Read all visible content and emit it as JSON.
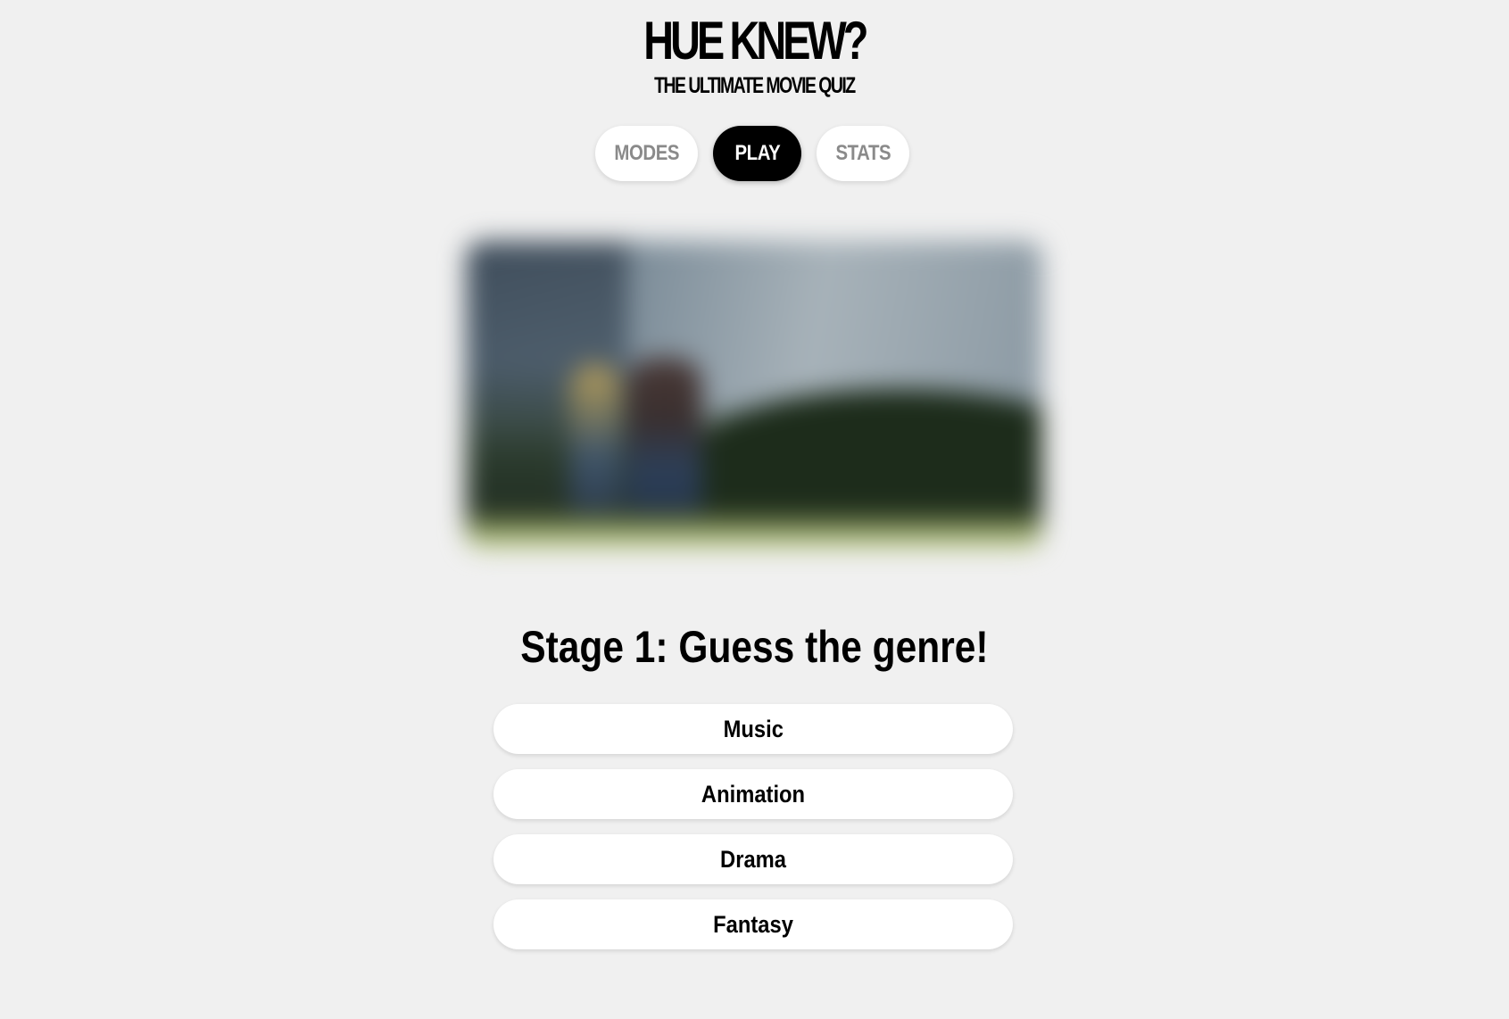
{
  "header": {
    "title": "HUE KNEW?",
    "subtitle": "THE ULTIMATE MOVIE QUIZ"
  },
  "nav": {
    "items": [
      {
        "label": "MODES",
        "active": false
      },
      {
        "label": "PLAY",
        "active": true
      },
      {
        "label": "STATS",
        "active": false
      }
    ]
  },
  "quiz": {
    "stage_title": "Stage 1: Guess the genre!",
    "options": [
      "Music",
      "Animation",
      "Drama",
      "Fantasy"
    ]
  },
  "colors": {
    "background": "#f0f0f0",
    "active_tab": "#000000",
    "inactive_tab_text": "#8a8a8a"
  }
}
